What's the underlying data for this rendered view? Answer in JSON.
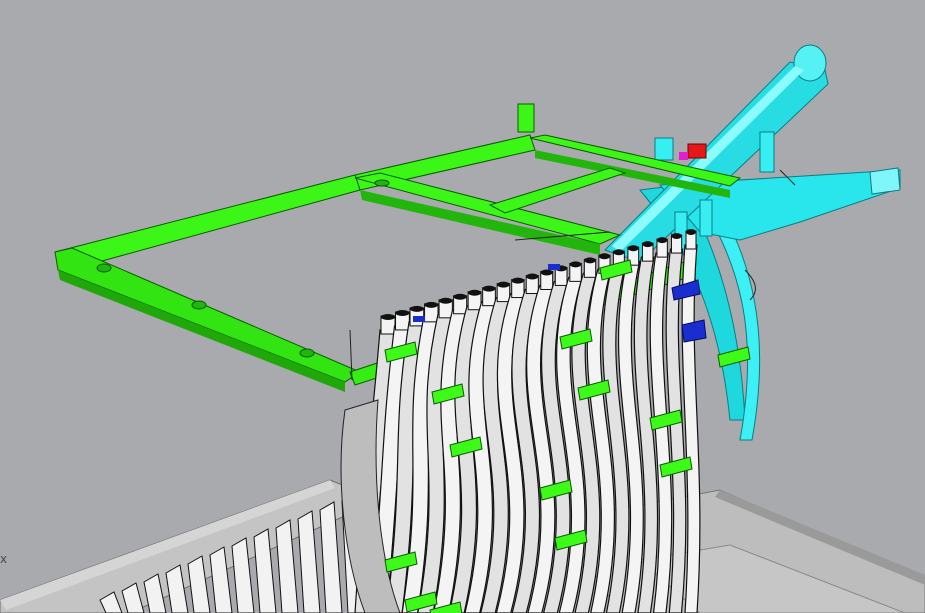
{
  "viewport": {
    "axis_label": "x",
    "background_color": "#a8aaad"
  },
  "colors": {
    "frame": "#3dfa18",
    "frame_shade": "#22b60c",
    "frame_outline": "#0c5c00",
    "rib_light": "#f4f4f4",
    "rib_shade": "#9c9c9c",
    "cyan": "#23e9ef",
    "cyan_shade": "#10a7b0",
    "blue_block": "#1a2fcf",
    "red_block": "#e21a1a",
    "magenta_block": "#e01fcf",
    "base_plate": "#b9b9b9",
    "base_plate_edge": "#7e7e7e"
  },
  "scene": {
    "rib_count": 22,
    "spacer_count": 14
  }
}
